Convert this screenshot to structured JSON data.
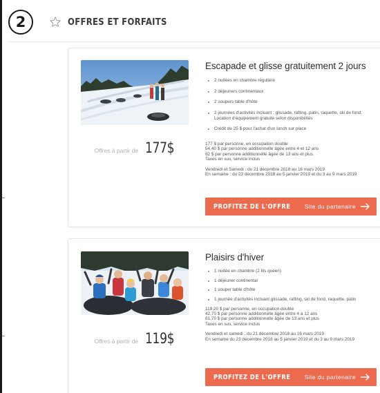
{
  "header": {
    "step_number": "2",
    "title": "OFFRES ET FORFAITS"
  },
  "offers": [
    {
      "title": "Escapade et glisse gratuitement 2 jours",
      "bullets": [
        "2 nuitées en chambre régulière",
        "2 déjeuners continentaux",
        "2 soupers table d'hôte",
        "2 journées d'activités incluant : glissade, rafting, patin, raquette, ski de fond. Location d'équipement gratuite selon disponibilités",
        "Crédit de 25 $ pour l'achat d'un lunch sur place"
      ],
      "pricing_lines": [
        "177 $ par personne, en occupation double",
        "54,40 $ par personne additionnelle âgée entre 4 et 12 ans",
        "82 $ par personne additionnelle âgée de 13 ans et plus",
        "Taxes en sus, service inclus"
      ],
      "date_lines": [
        "Vendredi et Samedi : du 21 décembre 2018 au 16 mars 2019",
        "En semaine : du 23 décembre 2018 au 5 janvier 2019 et du 3 au 9 mars 2019"
      ],
      "price_label": "Offres à partir de",
      "price": "177$",
      "cta_label": "PROFITEZ DE L'OFFRE",
      "partner_label": "Site du partenaire"
    },
    {
      "title": "Plaisirs d'hiver",
      "bullets": [
        "1 nuitée en chambre  (2 lits queen)",
        "1 déjeuner continental",
        "1 souper table d'hôte",
        "1 journée d'activités incluant glissade, rafting, ski de fond, raquette, patin"
      ],
      "pricing_lines": [
        "119,20 $ par personne, en occupation double",
        "42,70 $ par personne additionnelle âgée entre 4 à 12 ans",
        "61,70 $ par personne additionnelle âgée de 13 ans et plus",
        "Taxes en sus, service inclus"
      ],
      "date_lines": [
        "Vendredi et samedi : du 21 décembre 2018 au 16 mars 2019",
        "En semaine du 23 décembre 2018 au 5 janvier 2019 et du 3 au 9 mars 2019"
      ],
      "price_label": "Offres à partir de",
      "price": "119$",
      "cta_label": "PROFITEZ DE L'OFFRE",
      "partner_label": "Site du partenaire"
    }
  ],
  "icons": {
    "star": "star-outline-icon",
    "arrow": "arrow-right-icon"
  },
  "colors": {
    "accent": "#ec6a4e",
    "text": "#3a3a3a",
    "muted": "#b0b0b0"
  }
}
